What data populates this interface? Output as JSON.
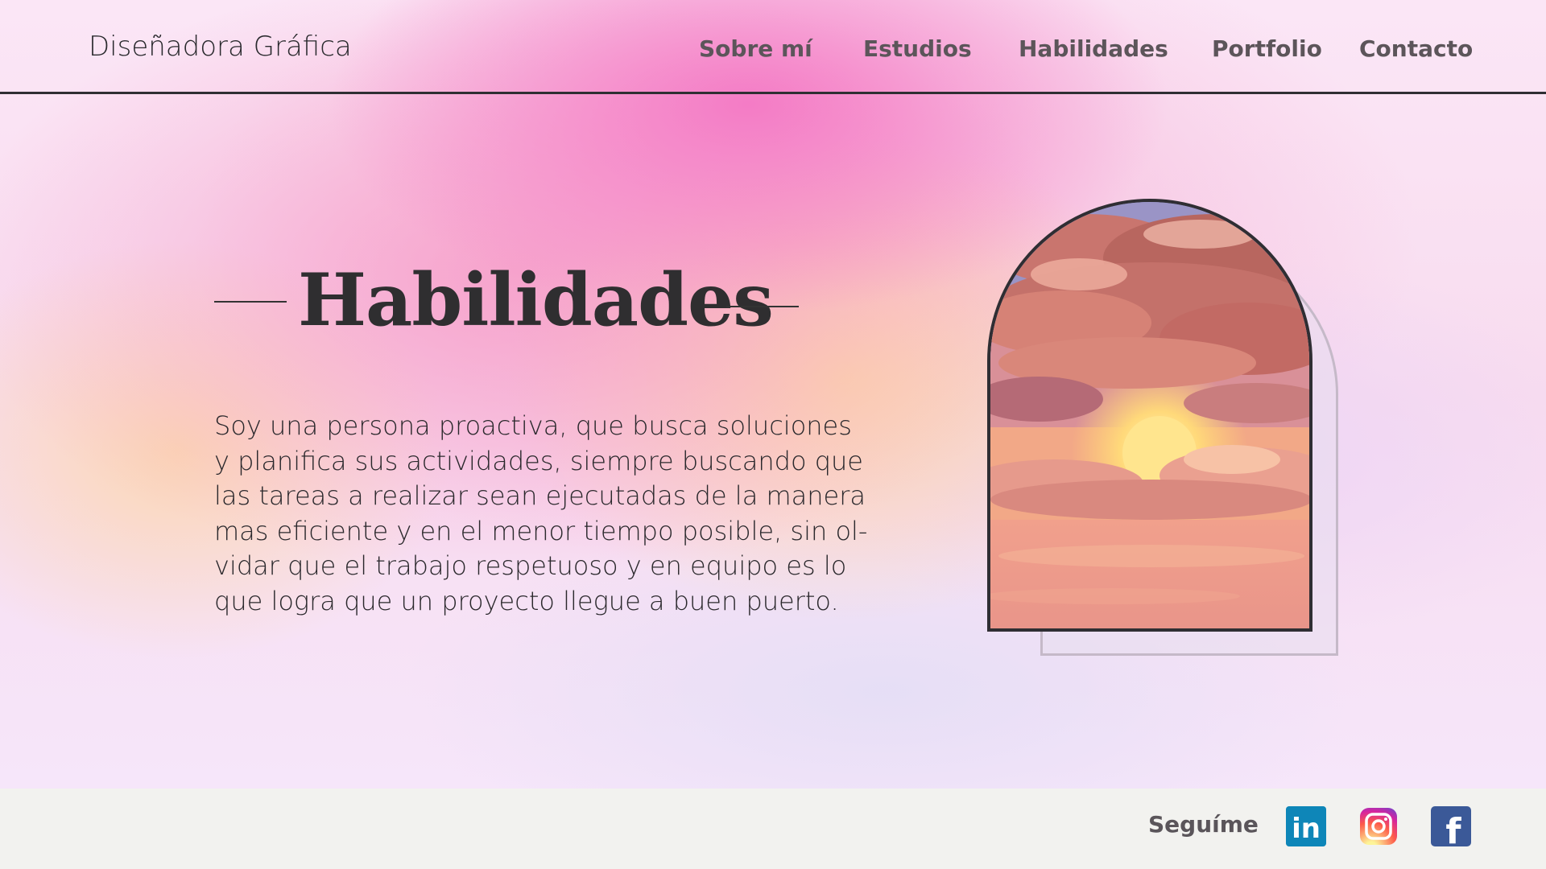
{
  "header": {
    "brand": "Diseñadora Gráfica",
    "nav": [
      {
        "label": "Sobre mí"
      },
      {
        "label": "Estudios"
      },
      {
        "label": "Habilidades"
      },
      {
        "label": "Portfolio"
      },
      {
        "label": "Contacto"
      }
    ]
  },
  "hero": {
    "title": "Habilidades",
    "body_lines": [
      "Soy una persona proactiva, que busca soluciones",
      "y planifica sus actividades, siempre buscando que",
      "las tareas a realizar sean ejecutadas de la manera",
      "mas eficiente y en el menor tiempo posible, sin ol-",
      "vidar que el trabajo respetuoso y en equipo es lo",
      "que logra que un proyecto llegue a buen puerto."
    ]
  },
  "footer": {
    "follow_label": "Seguíme",
    "social": [
      {
        "icon": "linkedin-icon",
        "label": "in",
        "color": "#0e76a8"
      },
      {
        "icon": "instagram-icon",
        "color": "#d6249f"
      },
      {
        "icon": "facebook-icon",
        "label": "f",
        "color": "#3b5998"
      }
    ]
  },
  "colors": {
    "accent_pink": "#f47cc4",
    "text_dark": "#2f2e30",
    "nav_text": "#5c555a",
    "footer_bg": "#f2f2ef"
  }
}
